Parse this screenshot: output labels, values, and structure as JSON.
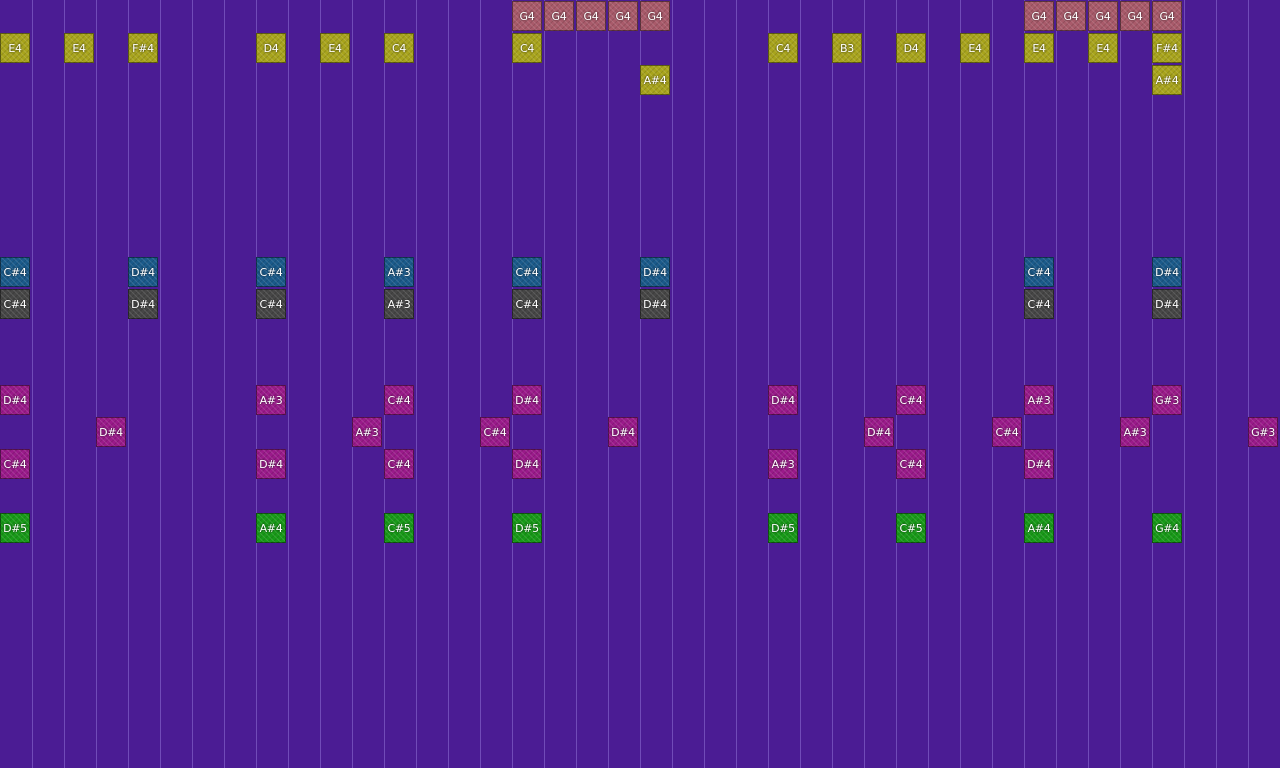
{
  "colors": {
    "background": "#4b1c94",
    "grid_line": "#8a6bd0",
    "melody": "#a8a41c",
    "lead": "#a85a6a",
    "chord_blue": "#1a5a8a",
    "chord_gray": "#464646",
    "harmony": "#9a1a8a",
    "bass": "#189a18"
  },
  "notes": [
    {
      "label": "G4",
      "col": 16,
      "row": 0,
      "track": "lead"
    },
    {
      "label": "G4",
      "col": 17,
      "row": 0,
      "track": "lead"
    },
    {
      "label": "G4",
      "col": 18,
      "row": 0,
      "track": "lead"
    },
    {
      "label": "G4",
      "col": 19,
      "row": 0,
      "track": "lead"
    },
    {
      "label": "G4",
      "col": 20,
      "row": 0,
      "track": "lead"
    },
    {
      "label": "G4",
      "col": 32,
      "row": 0,
      "track": "lead"
    },
    {
      "label": "G4",
      "col": 33,
      "row": 0,
      "track": "lead"
    },
    {
      "label": "G4",
      "col": 34,
      "row": 0,
      "track": "lead"
    },
    {
      "label": "G4",
      "col": 35,
      "row": 0,
      "track": "lead"
    },
    {
      "label": "G4",
      "col": 36,
      "row": 0,
      "track": "lead"
    },
    {
      "label": "E4",
      "col": 0,
      "row": 1,
      "track": "melody"
    },
    {
      "label": "E4",
      "col": 2,
      "row": 1,
      "track": "melody"
    },
    {
      "label": "F#4",
      "col": 4,
      "row": 1,
      "track": "melody"
    },
    {
      "label": "D4",
      "col": 8,
      "row": 1,
      "track": "melody"
    },
    {
      "label": "E4",
      "col": 10,
      "row": 1,
      "track": "melody"
    },
    {
      "label": "C4",
      "col": 12,
      "row": 1,
      "track": "melody"
    },
    {
      "label": "C4",
      "col": 16,
      "row": 1,
      "track": "melody"
    },
    {
      "label": "C4",
      "col": 24,
      "row": 1,
      "track": "melody"
    },
    {
      "label": "B3",
      "col": 26,
      "row": 1,
      "track": "melody"
    },
    {
      "label": "D4",
      "col": 28,
      "row": 1,
      "track": "melody"
    },
    {
      "label": "E4",
      "col": 30,
      "row": 1,
      "track": "melody"
    },
    {
      "label": "E4",
      "col": 32,
      "row": 1,
      "track": "melody"
    },
    {
      "label": "E4",
      "col": 34,
      "row": 1,
      "track": "melody"
    },
    {
      "label": "F#4",
      "col": 36,
      "row": 1,
      "track": "melody"
    },
    {
      "label": "A#4",
      "col": 20,
      "row": 2,
      "track": "melody"
    },
    {
      "label": "A#4",
      "col": 36,
      "row": 2,
      "track": "melody"
    },
    {
      "label": "C#4",
      "col": 0,
      "row": 8,
      "track": "chord_blue"
    },
    {
      "label": "D#4",
      "col": 4,
      "row": 8,
      "track": "chord_blue"
    },
    {
      "label": "C#4",
      "col": 8,
      "row": 8,
      "track": "chord_blue"
    },
    {
      "label": "A#3",
      "col": 12,
      "row": 8,
      "track": "chord_blue"
    },
    {
      "label": "C#4",
      "col": 16,
      "row": 8,
      "track": "chord_blue"
    },
    {
      "label": "D#4",
      "col": 20,
      "row": 8,
      "track": "chord_blue"
    },
    {
      "label": "C#4",
      "col": 32,
      "row": 8,
      "track": "chord_blue"
    },
    {
      "label": "D#4",
      "col": 36,
      "row": 8,
      "track": "chord_blue"
    },
    {
      "label": "C#4",
      "col": 0,
      "row": 9,
      "track": "chord_gray"
    },
    {
      "label": "D#4",
      "col": 4,
      "row": 9,
      "track": "chord_gray"
    },
    {
      "label": "C#4",
      "col": 8,
      "row": 9,
      "track": "chord_gray"
    },
    {
      "label": "A#3",
      "col": 12,
      "row": 9,
      "track": "chord_gray"
    },
    {
      "label": "C#4",
      "col": 16,
      "row": 9,
      "track": "chord_gray"
    },
    {
      "label": "D#4",
      "col": 20,
      "row": 9,
      "track": "chord_gray"
    },
    {
      "label": "C#4",
      "col": 32,
      "row": 9,
      "track": "chord_gray"
    },
    {
      "label": "D#4",
      "col": 36,
      "row": 9,
      "track": "chord_gray"
    },
    {
      "label": "D#4",
      "col": 0,
      "row": 12,
      "track": "harmony"
    },
    {
      "label": "A#3",
      "col": 8,
      "row": 12,
      "track": "harmony"
    },
    {
      "label": "C#4",
      "col": 12,
      "row": 12,
      "track": "harmony"
    },
    {
      "label": "D#4",
      "col": 16,
      "row": 12,
      "track": "harmony"
    },
    {
      "label": "D#4",
      "col": 24,
      "row": 12,
      "track": "harmony"
    },
    {
      "label": "C#4",
      "col": 28,
      "row": 12,
      "track": "harmony"
    },
    {
      "label": "A#3",
      "col": 32,
      "row": 12,
      "track": "harmony"
    },
    {
      "label": "G#3",
      "col": 36,
      "row": 12,
      "track": "harmony"
    },
    {
      "label": "D#4",
      "col": 3,
      "row": 13,
      "track": "harmony"
    },
    {
      "label": "A#3",
      "col": 11,
      "row": 13,
      "track": "harmony"
    },
    {
      "label": "C#4",
      "col": 15,
      "row": 13,
      "track": "harmony"
    },
    {
      "label": "D#4",
      "col": 19,
      "row": 13,
      "track": "harmony"
    },
    {
      "label": "D#4",
      "col": 27,
      "row": 13,
      "track": "harmony"
    },
    {
      "label": "C#4",
      "col": 31,
      "row": 13,
      "track": "harmony"
    },
    {
      "label": "A#3",
      "col": 35,
      "row": 13,
      "track": "harmony"
    },
    {
      "label": "G#3",
      "col": 39,
      "row": 13,
      "track": "harmony"
    },
    {
      "label": "C#4",
      "col": 0,
      "row": 14,
      "track": "harmony"
    },
    {
      "label": "D#4",
      "col": 8,
      "row": 14,
      "track": "harmony"
    },
    {
      "label": "C#4",
      "col": 12,
      "row": 14,
      "track": "harmony"
    },
    {
      "label": "D#4",
      "col": 16,
      "row": 14,
      "track": "harmony"
    },
    {
      "label": "A#3",
      "col": 24,
      "row": 14,
      "track": "harmony"
    },
    {
      "label": "C#4",
      "col": 28,
      "row": 14,
      "track": "harmony"
    },
    {
      "label": "D#4",
      "col": 32,
      "row": 14,
      "track": "harmony"
    },
    {
      "label": "D#5",
      "col": 0,
      "row": 16,
      "track": "bass"
    },
    {
      "label": "A#4",
      "col": 8,
      "row": 16,
      "track": "bass"
    },
    {
      "label": "C#5",
      "col": 12,
      "row": 16,
      "track": "bass"
    },
    {
      "label": "D#5",
      "col": 16,
      "row": 16,
      "track": "bass"
    },
    {
      "label": "D#5",
      "col": 24,
      "row": 16,
      "track": "bass"
    },
    {
      "label": "C#5",
      "col": 28,
      "row": 16,
      "track": "bass"
    },
    {
      "label": "A#4",
      "col": 32,
      "row": 16,
      "track": "bass"
    },
    {
      "label": "G#4",
      "col": 36,
      "row": 16,
      "track": "bass"
    }
  ]
}
